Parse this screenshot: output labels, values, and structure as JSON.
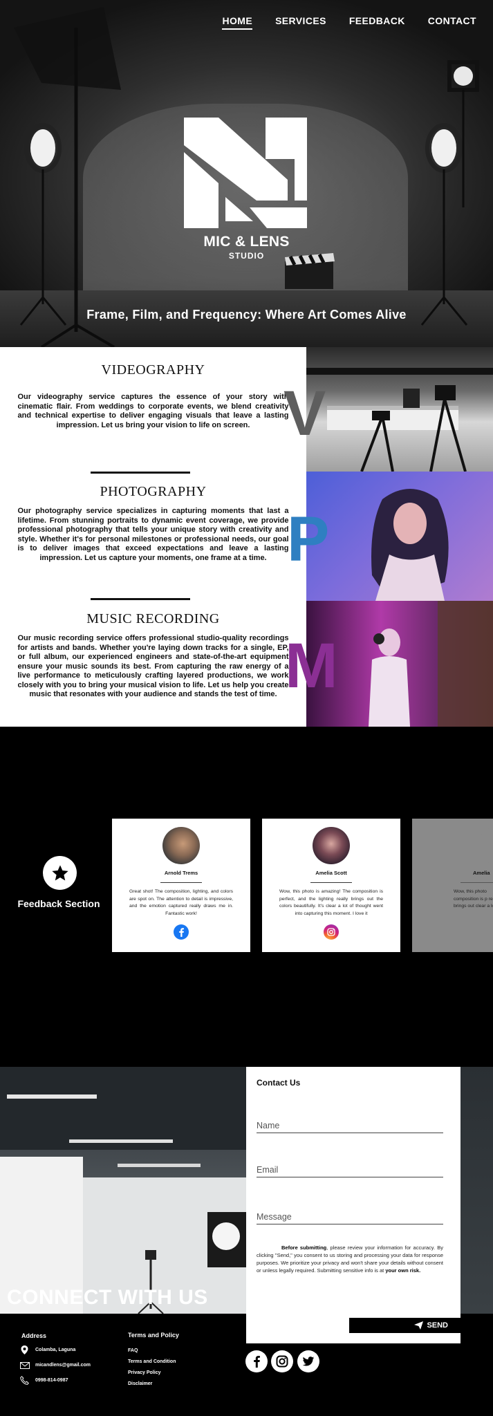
{
  "nav": {
    "items": [
      {
        "label": "HOME",
        "active": true
      },
      {
        "label": "SERVICES",
        "active": false
      },
      {
        "label": "FEEDBACK",
        "active": false
      },
      {
        "label": "CONTACT",
        "active": false
      }
    ]
  },
  "hero": {
    "brand": "MIC & LENS",
    "brand_sub": "STUDIO",
    "tagline": "Frame, Film, and Frequency: Where Art Comes Alive"
  },
  "services": [
    {
      "title": "VIDEOGRAPHY",
      "letter": "V",
      "letter_color": "#5e5e5e",
      "description": "Our videography service captures the essence of your story with cinematic flair. From weddings to corporate events, we blend creativity and technical expertise to deliver engaging visuals that leave a lasting impression. Let us bring your vision to life on screen."
    },
    {
      "title": "PHOTOGRAPHY",
      "letter": "P",
      "letter_color": "#2f7fc1",
      "description": "Our photography service specializes in capturing moments that last a lifetime. From stunning portraits to dynamic event coverage, we provide professional photography that tells your unique story with creativity and style. Whether it's for personal milestones or professional needs, our goal is to deliver images that exceed expectations and leave a lasting impression. Let us capture your moments, one frame at a time."
    },
    {
      "title": "MUSIC RECORDING",
      "letter": "M",
      "letter_color": "#8b2f94",
      "description": "Our music recording service offers professional studio-quality recordings for artists and bands. Whether you're laying down tracks for a single, EP, or full album, our experienced engineers and state-of-the-art equipment ensure your music sounds its best. From capturing the raw energy of a live performance to meticulously crafting layered productions, we work closely with you to bring your musical vision to life. Let us help you create music that resonates with your audience and stands the test of time."
    }
  ],
  "feedback": {
    "heading": "Feedback Section",
    "icon": "star-icon",
    "cards": [
      {
        "name": "Arnold Trems",
        "review": "Great shot! The composition, lighting, and colors are spot on. The attention to detail is impressive, and the emotion captured really draws me in. Fantastic work!",
        "social": "facebook-icon"
      },
      {
        "name": "Amelia Scott",
        "review": "Wow, this photo is amazing! The composition is perfect, and the lighting really brings out the colors beautifully. It's clear a lot of thought went into capturing this moment. I love it",
        "social": "instagram-icon"
      },
      {
        "name": "Amelia",
        "review": "Wow, this photo composition is p really brings out clear a lot of th",
        "social": ""
      }
    ]
  },
  "contact": {
    "banner": "CONNECT WITH US",
    "form_title": "Contact Us",
    "name_placeholder": "Name",
    "email_placeholder": "Email",
    "message_placeholder": "Message",
    "consent_lead": "Before submitting",
    "consent_body": ", please review your information for accuracy. By clicking \"Send,\" you consent to us storing and processing your data for response purposes. We prioritize your privacy and won't share your details without consent or unless legally required. Submitting sensitive info is at ",
    "consent_tail": "your own risk.",
    "send_label": "SEND"
  },
  "footer": {
    "address_title": "Address",
    "address": "Colamba, Laguna",
    "email": "micandlens@gmail.com",
    "phone": "0998-814-0987",
    "terms_title": "Terms and Policy",
    "links": [
      "FAQ",
      "Terms and Condition",
      "Privacy Policy",
      "Disclaimer"
    ],
    "socials": [
      "facebook-icon",
      "instagram-icon",
      "twitter-icon"
    ]
  }
}
